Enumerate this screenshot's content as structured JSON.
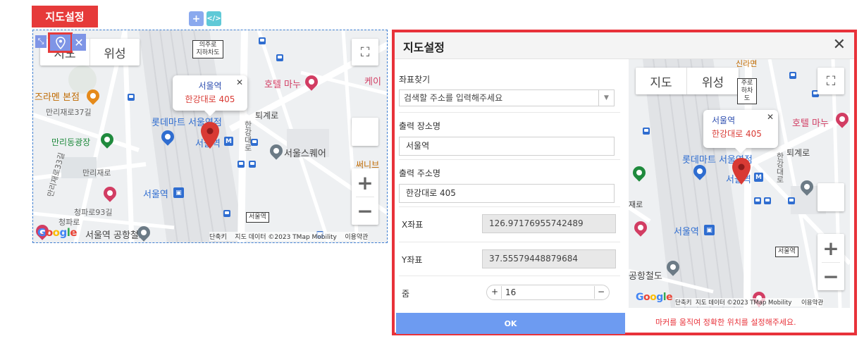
{
  "widget": {
    "title_tag": "지도설정",
    "add_btn": "+",
    "code_btn": "</>",
    "remove_btn": "✕",
    "move_btn": "⤡"
  },
  "map_small": {
    "map_type": [
      "지도",
      "위성"
    ],
    "infowindow": {
      "line1": "서울역",
      "line2": "한강대로 405",
      "close": "✕"
    },
    "labels": {
      "uiju_tunnel": "의주로\n지하차도",
      "hotel_manu": "호텔 마누",
      "jjalamen": "즈라멘 본점",
      "malli37": "만리재로37길",
      "lotte_mart": "롯데마트 서울역점",
      "seoul_station_pin": "서울역",
      "toegyero": "퇴계로",
      "hangang": "한강대로",
      "manlidong": "만리동광장",
      "seoul_square": "서울스퀘어",
      "malli33": "만리재로33길",
      "malli_road": "만리재로",
      "seoul_station": "서울역",
      "cheongpa93": "청파로93길",
      "cheongpa_road": "청파로",
      "airport_rail": "서울역 공항철도",
      "seoul_box": "서울역",
      "ke": "케이",
      "sunny": "써니브"
    },
    "attribution": {
      "shortcut": "단축키",
      "data": "지도 데이터 ©2023 TMap Mobility",
      "terms": "이용약관"
    },
    "google": "Google"
  },
  "dialog": {
    "title": "지도설정",
    "close": "✕",
    "fields": {
      "search_label": "좌표찾기",
      "search_placeholder": "검색할 주소를 입력해주세요",
      "place_label": "출력 장소명",
      "place_value": "서울역",
      "address_label": "출력 주소명",
      "address_value": "한강대로 405",
      "x_label": "X좌표",
      "x_value": "126.97176955742489",
      "y_label": "Y좌표",
      "y_value": "37.55579448879684",
      "zoom_label": "줌",
      "zoom_value": "16",
      "zoom_plus": "+",
      "zoom_minus": "−"
    },
    "ok": "OK",
    "hint": "마커를 움직여 정확한 위치를 설정해주세요."
  },
  "map_big": {
    "map_type": [
      "지도",
      "위성"
    ],
    "infowindow": {
      "line1": "서울역",
      "line2": "한강대로 405",
      "close": "✕"
    },
    "labels": {
      "uiju_box": "주로\n하차도",
      "sindang": "신라면",
      "hotel_manu": "호텔 마누",
      "lotte_mart": "롯데마트 서울역점",
      "seoul_station_pin": "서울역",
      "toegyero": "퇴계로",
      "hangang": "한강대로",
      "seoul_station": "서울역",
      "road_ro": "재로",
      "airport": "공항철도",
      "seoul_box": "서울역"
    },
    "attribution": {
      "shortcut": "단축키",
      "data": "지도 데이터 ©2023 TMap Mobility",
      "terms": "이용약관"
    },
    "google": "Google"
  },
  "colors": {
    "accent_red": "#e63a3a",
    "ok_blue": "#6d9bf1",
    "marker_red": "#d93a34"
  }
}
